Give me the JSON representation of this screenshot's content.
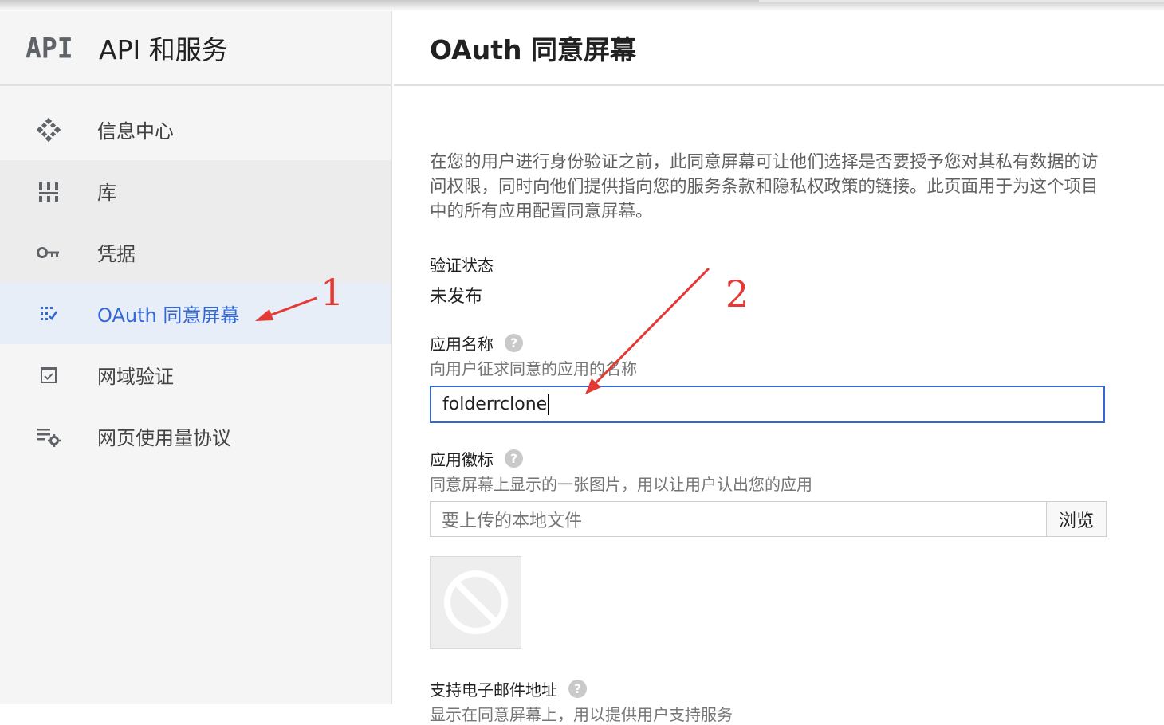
{
  "sidebar": {
    "logo_text": "API",
    "product_title": "API 和服务",
    "items": [
      {
        "label": "信息中心",
        "icon": "dashboard-icon"
      },
      {
        "label": "库",
        "icon": "library-icon"
      },
      {
        "label": "凭据",
        "icon": "key-icon"
      },
      {
        "label": "OAuth 同意屏幕",
        "icon": "consent-icon",
        "active": true
      },
      {
        "label": "网域验证",
        "icon": "checkbox-icon"
      },
      {
        "label": "网页使用量协议",
        "icon": "settings-list-icon"
      }
    ]
  },
  "main": {
    "title": "OAuth 同意屏幕",
    "intro": "在您的用户进行身份验证之前，此同意屏幕可让他们选择是否要授予您对其私有数据的访问权限，同时向他们提供指向您的服务条款和隐私权政策的链接。此页面用于为这个项目中的所有应用配置同意屏幕。",
    "verification": {
      "label": "验证状态",
      "value": "未发布"
    },
    "app_name": {
      "label": "应用名称",
      "hint": "向用户征求同意的应用的名称",
      "value": "folderrclone"
    },
    "app_logo": {
      "label": "应用徽标",
      "hint": "同意屏幕上显示的一张图片，用以让用户认出您的应用",
      "placeholder": "要上传的本地文件",
      "browse_label": "浏览"
    },
    "support_email": {
      "label": "支持电子邮件地址",
      "hint": "显示在同意屏幕上，用以提供用户支持服务"
    },
    "help_glyph": "?"
  },
  "annotations": {
    "step1": "1",
    "step2": "2",
    "color": "#e53935"
  },
  "colors": {
    "accent": "#3367d6",
    "sidebar_bg": "#f5f5f5",
    "active_bg": "#e8eef8"
  }
}
